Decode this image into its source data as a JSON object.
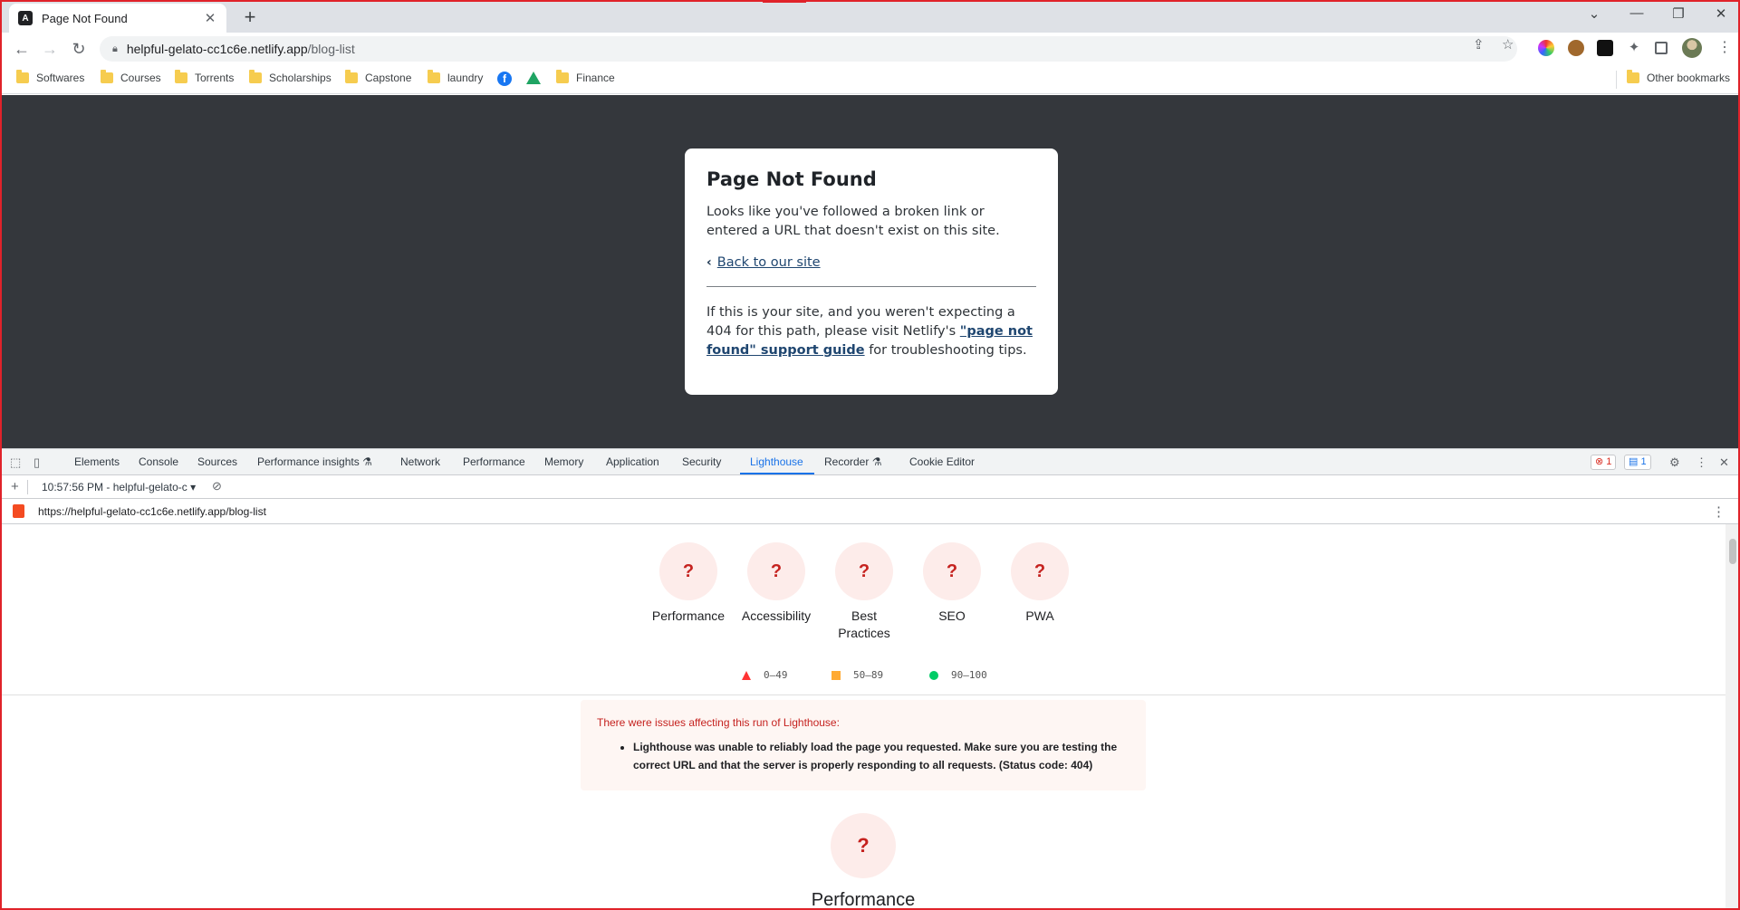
{
  "browser": {
    "tab_title": "Page Not Found",
    "tab_favicon": "A",
    "url_host": "helpful-gelato-cc1c6e.netlify.app",
    "url_path": "/blog-list",
    "bookmarks": [
      "Softwares",
      "Courses",
      "Torrents",
      "Scholarships",
      "Capstone",
      "laundry",
      "Finance"
    ],
    "other_bookmarks": "Other bookmarks"
  },
  "page": {
    "heading": "Page Not Found",
    "intro": "Looks like you've followed a broken link or entered a URL that doesn't exist on this site.",
    "back_link": "Back to our site",
    "footer_pre": "If this is your site, and you weren't expecting a 404 for this path, please visit Netlify's ",
    "footer_link": "\"page not found\" support guide",
    "footer_post": " for troubleshooting tips."
  },
  "devtools": {
    "tabs": [
      "Elements",
      "Console",
      "Sources",
      "Performance insights",
      "Network",
      "Performance",
      "Memory",
      "Application",
      "Security",
      "Lighthouse",
      "Recorder",
      "Cookie Editor"
    ],
    "active_tab": "Lighthouse",
    "error_count": "1",
    "message_count": "1",
    "session": "10:57:56 PM - helpful-gelato-c",
    "report_url": "https://helpful-gelato-cc1c6e.netlify.app/blog-list"
  },
  "lighthouse": {
    "categories": [
      {
        "label": "Performance",
        "score": "?"
      },
      {
        "label": "Accessibility",
        "score": "?"
      },
      {
        "label": "Best Practices",
        "score": "?"
      },
      {
        "label": "SEO",
        "score": "?"
      },
      {
        "label": "PWA",
        "score": "?"
      }
    ],
    "legend": {
      "fail": "0–49",
      "average": "50–89",
      "pass": "90–100"
    },
    "warning_title": "There were issues affecting this run of Lighthouse:",
    "warning_item": "Lighthouse was unable to reliably load the page you requested. Make sure you are testing the correct URL and that the server is properly responding to all requests. (Status code: 404)",
    "section_score": "?",
    "section_title": "Performance"
  },
  "colors": {
    "accent": "#1a73e8",
    "page_bg": "#34373c",
    "fail": "#c5221f"
  }
}
